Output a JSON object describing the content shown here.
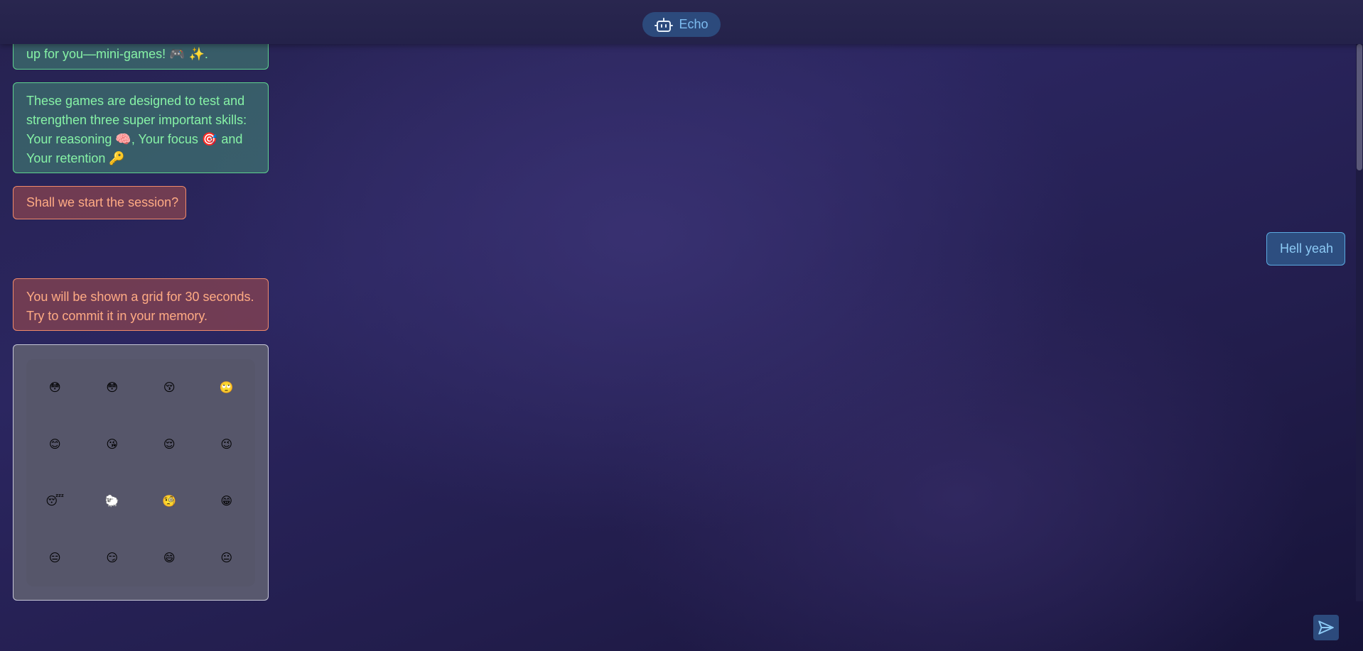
{
  "header": {
    "title": "Echo",
    "icon": "robot-icon"
  },
  "messages": [
    {
      "from": "bot",
      "tone": "green",
      "text": "up for you—mini-games! 🎮 ✨."
    },
    {
      "from": "bot",
      "tone": "green",
      "text": "These games are designed to test and strengthen three super important skills: Your reasoning 🧠, Your focus 🎯 and Your retention 🔑"
    },
    {
      "from": "bot",
      "tone": "red",
      "text": "Shall we start the session?"
    },
    {
      "from": "user",
      "tone": "blue",
      "text": "Hell yeah"
    },
    {
      "from": "bot",
      "tone": "red",
      "text": "You will be shown a grid for 30 seconds. Try to commit it in your memory."
    }
  ],
  "emoji_grid": [
    [
      "😳",
      "😳",
      "😚",
      "🙄"
    ],
    [
      "😊",
      "😘",
      "😌",
      "😉"
    ],
    [
      "😴",
      "🐑",
      "🧐",
      "😁"
    ],
    [
      "😑",
      "😏",
      "😄",
      "😐"
    ]
  ],
  "composer": {
    "send_icon": "send-icon"
  },
  "colors": {
    "accent": "#2c4a7c",
    "bot_green_text": "#86f2a6",
    "bot_red_text": "#ffab84",
    "user_blue_text": "#8ccaf5"
  }
}
